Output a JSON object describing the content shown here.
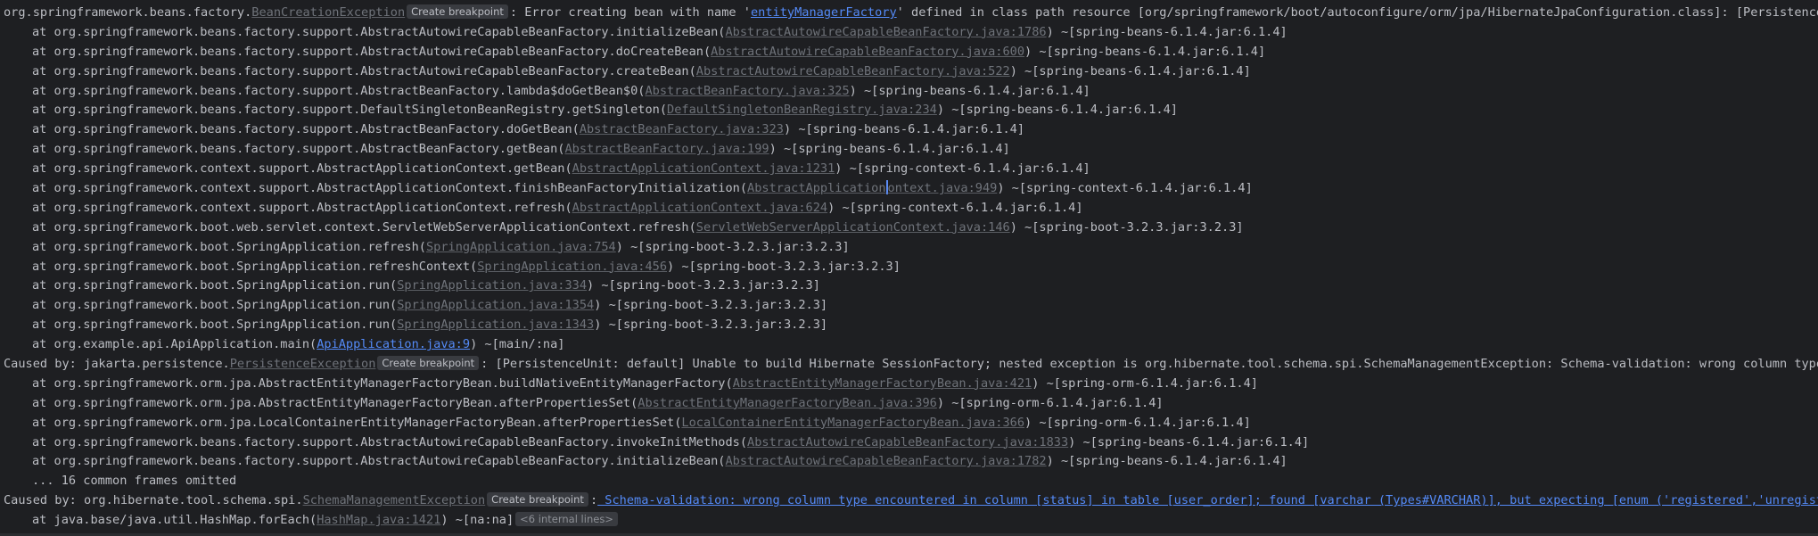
{
  "console": {
    "header": {
      "prefix": "org.springframework.beans.factory.",
      "exc": "BeanCreationException",
      "badge": "Create breakpoint",
      "msg1": ": Error creating bean with name '",
      "bean": "entityManagerFactory",
      "msg2": "' defined in class path resource [org/springframework/boot/autoconfigure/orm/jpa/HibernateJpaConfiguration.class]: [PersistenceUnit: default] Unable to build Hibernate SessionFactory"
    },
    "frames1": [
      {
        "pre": "at org.springframework.beans.factory.support.AbstractAutowireCapableBeanFactory.initializeBean(",
        "link": "AbstractAutowireCapableBeanFactory.java:1786",
        "post": ") ~[spring-beans-6.1.4.jar:6.1.4]"
      },
      {
        "pre": "at org.springframework.beans.factory.support.AbstractAutowireCapableBeanFactory.doCreateBean(",
        "link": "AbstractAutowireCapableBeanFactory.java:600",
        "post": ") ~[spring-beans-6.1.4.jar:6.1.4]"
      },
      {
        "pre": "at org.springframework.beans.factory.support.AbstractAutowireCapableBeanFactory.createBean(",
        "link": "AbstractAutowireCapableBeanFactory.java:522",
        "post": ") ~[spring-beans-6.1.4.jar:6.1.4]"
      },
      {
        "pre": "at org.springframework.beans.factory.support.AbstractBeanFactory.lambda$doGetBean$0(",
        "link": "AbstractBeanFactory.java:325",
        "post": ") ~[spring-beans-6.1.4.jar:6.1.4]"
      },
      {
        "pre": "at org.springframework.beans.factory.support.DefaultSingletonBeanRegistry.getSingleton(",
        "link": "DefaultSingletonBeanRegistry.java:234",
        "post": ") ~[spring-beans-6.1.4.jar:6.1.4]"
      },
      {
        "pre": "at org.springframework.beans.factory.support.AbstractBeanFactory.doGetBean(",
        "link": "AbstractBeanFactory.java:323",
        "post": ") ~[spring-beans-6.1.4.jar:6.1.4]"
      },
      {
        "pre": "at org.springframework.beans.factory.support.AbstractBeanFactory.getBean(",
        "link": "AbstractBeanFactory.java:199",
        "post": ") ~[spring-beans-6.1.4.jar:6.1.4]"
      },
      {
        "pre": "at org.springframework.context.support.AbstractApplicationContext.getBean(",
        "link": "AbstractApplicationContext.java:1231",
        "post": ") ~[spring-context-6.1.4.jar:6.1.4]"
      },
      {
        "pre": "at org.springframework.context.support.AbstractApplicationContext.finishBeanFactoryInitialization(",
        "link": "AbstractApplicationContext.java:949",
        "post": ") ~[spring-context-6.1.4.jar:6.1.4]"
      },
      {
        "pre": "at org.springframework.context.support.AbstractApplicationContext.refresh(",
        "link": "AbstractApplicationContext.java:624",
        "post": ") ~[spring-context-6.1.4.jar:6.1.4]"
      },
      {
        "pre": "at org.springframework.boot.web.servlet.context.ServletWebServerApplicationContext.refresh(",
        "link": "ServletWebServerApplicationContext.java:146",
        "post": ") ~[spring-boot-3.2.3.jar:3.2.3]"
      },
      {
        "pre": "at org.springframework.boot.SpringApplication.refresh(",
        "link": "SpringApplication.java:754",
        "post": ") ~[spring-boot-3.2.3.jar:3.2.3]"
      },
      {
        "pre": "at org.springframework.boot.SpringApplication.refreshContext(",
        "link": "SpringApplication.java:456",
        "post": ") ~[spring-boot-3.2.3.jar:3.2.3]"
      },
      {
        "pre": "at org.springframework.boot.SpringApplication.run(",
        "link": "SpringApplication.java:334",
        "post": ") ~[spring-boot-3.2.3.jar:3.2.3]"
      },
      {
        "pre": "at org.springframework.boot.SpringApplication.run(",
        "link": "SpringApplication.java:1354",
        "post": ") ~[spring-boot-3.2.3.jar:3.2.3]"
      },
      {
        "pre": "at org.springframework.boot.SpringApplication.run(",
        "link": "SpringApplication.java:1343",
        "post": ") ~[spring-boot-3.2.3.jar:3.2.3]"
      }
    ],
    "main_frame": {
      "pre": "at org.example.api.ApiApplication.main(",
      "link": "ApiApplication.java:9",
      "post": ") ~[main/:na]"
    },
    "cause1": {
      "prefix": "Caused by: jakarta.persistence.",
      "exc": "PersistenceException",
      "badge": "Create breakpoint",
      "msg": ": [PersistenceUnit: default] Unable to build Hibernate SessionFactory; nested exception is org.hibernate.tool.schema.spi.SchemaManagementException: Schema-validation: wrong column type encountered in column [status] in table [user_order]"
    },
    "frames2": [
      {
        "pre": "at org.springframework.orm.jpa.AbstractEntityManagerFactoryBean.buildNativeEntityManagerFactory(",
        "link": "AbstractEntityManagerFactoryBean.java:421",
        "post": ") ~[spring-orm-6.1.4.jar:6.1.4]"
      },
      {
        "pre": "at org.springframework.orm.jpa.AbstractEntityManagerFactoryBean.afterPropertiesSet(",
        "link": "AbstractEntityManagerFactoryBean.java:396",
        "post": ") ~[spring-orm-6.1.4.jar:6.1.4]"
      },
      {
        "pre": "at org.springframework.orm.jpa.LocalContainerEntityManagerFactoryBean.afterPropertiesSet(",
        "link": "LocalContainerEntityManagerFactoryBean.java:366",
        "post": ") ~[spring-orm-6.1.4.jar:6.1.4]"
      },
      {
        "pre": "at org.springframework.beans.factory.support.AbstractAutowireCapableBeanFactory.invokeInitMethods(",
        "link": "AbstractAutowireCapableBeanFactory.java:1833",
        "post": ") ~[spring-beans-6.1.4.jar:6.1.4]"
      },
      {
        "pre": "at org.springframework.beans.factory.support.AbstractAutowireCapableBeanFactory.initializeBean(",
        "link": "AbstractAutowireCapableBeanFactory.java:1782",
        "post": ") ~[spring-beans-6.1.4.jar:6.1.4]"
      }
    ],
    "omitted": "... 16 common frames omitted",
    "cause2": {
      "prefix": "Caused by: org.hibernate.tool.schema.spi.",
      "exc": "SchemaManagementException",
      "badge": "Create breakpoint",
      "colon": ":",
      "msg": " Schema-validation: wrong column type encountered in column [status] in table [user_order]; found [varchar (Types#VARCHAR)], but expecting [enum ('registered','unregistered') (Types#ENUM)]"
    },
    "last_frame": {
      "pre": "at java.base/java.util.HashMap.forEach(",
      "link": "HashMap.java:1421",
      "post": ") ~[na:na]",
      "badge": "<6 internal lines>"
    }
  }
}
